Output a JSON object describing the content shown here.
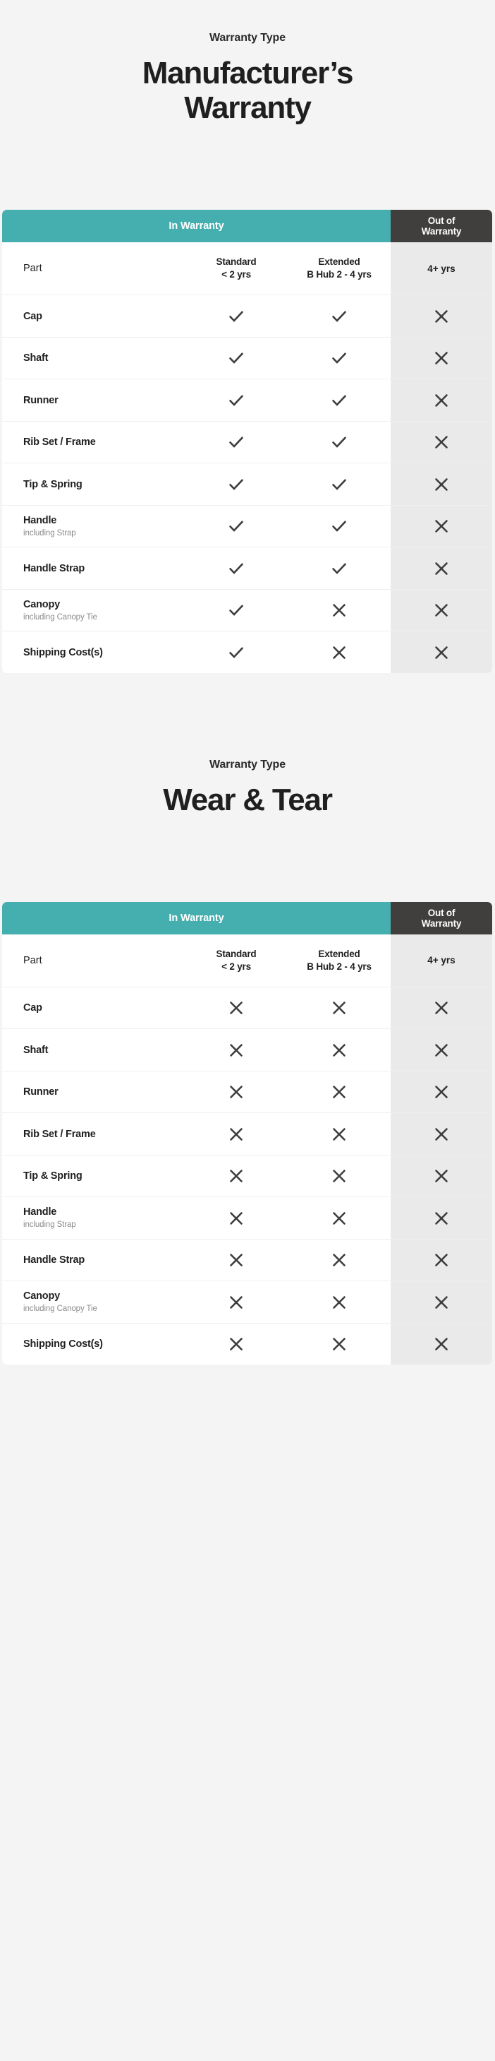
{
  "colors": {
    "teal": "#44AFAE",
    "dark": "#413F3D",
    "page_background": "#F4F4F4",
    "row_background": "#FFFFFF",
    "out_of_warranty_background": "#EAEAEA",
    "muted_text": "#8C8C8C"
  },
  "sections": [
    {
      "eyebrow": "Warranty Type",
      "title_line1": "Manufacturer’s",
      "title_line2": "Warranty",
      "table": {
        "banner": {
          "in_warranty": "In Warranty",
          "out_of_warranty_line1": "Out of",
          "out_of_warranty_line2": "Warranty"
        },
        "columns": {
          "part": "Part",
          "standard_line1": "Standard",
          "standard_line2": "< 2 yrs",
          "extended_line1": "Extended",
          "extended_line2": "B Hub 2 - 4 yrs",
          "out_of_warranty": "4+ yrs"
        },
        "rows": [
          {
            "part": "Cap",
            "sub": "",
            "standard": "check",
            "extended": "check",
            "out": "cross"
          },
          {
            "part": "Shaft",
            "sub": "",
            "standard": "check",
            "extended": "check",
            "out": "cross"
          },
          {
            "part": "Runner",
            "sub": "",
            "standard": "check",
            "extended": "check",
            "out": "cross"
          },
          {
            "part": "Rib Set / Frame",
            "sub": "",
            "standard": "check",
            "extended": "check",
            "out": "cross"
          },
          {
            "part": "Tip & Spring",
            "sub": "",
            "standard": "check",
            "extended": "check",
            "out": "cross"
          },
          {
            "part": "Handle",
            "sub": "including Strap",
            "standard": "check",
            "extended": "check",
            "out": "cross"
          },
          {
            "part": "Handle Strap",
            "sub": "",
            "standard": "check",
            "extended": "check",
            "out": "cross"
          },
          {
            "part": "Canopy",
            "sub": "including Canopy Tie",
            "standard": "check",
            "extended": "cross",
            "out": "cross"
          },
          {
            "part": "Shipping Cost(s)",
            "sub": "",
            "standard": "check",
            "extended": "cross",
            "out": "cross"
          }
        ]
      }
    },
    {
      "eyebrow": "Warranty Type",
      "title_line1": "Wear & Tear",
      "title_line2": "",
      "table": {
        "banner": {
          "in_warranty": "In Warranty",
          "out_of_warranty_line1": "Out of",
          "out_of_warranty_line2": "Warranty"
        },
        "columns": {
          "part": "Part",
          "standard_line1": "Standard",
          "standard_line2": "< 2 yrs",
          "extended_line1": "Extended",
          "extended_line2": "B Hub 2 - 4 yrs",
          "out_of_warranty": "4+ yrs"
        },
        "rows": [
          {
            "part": "Cap",
            "sub": "",
            "standard": "cross",
            "extended": "cross",
            "out": "cross"
          },
          {
            "part": "Shaft",
            "sub": "",
            "standard": "cross",
            "extended": "cross",
            "out": "cross"
          },
          {
            "part": "Runner",
            "sub": "",
            "standard": "cross",
            "extended": "cross",
            "out": "cross"
          },
          {
            "part": "Rib Set / Frame",
            "sub": "",
            "standard": "cross",
            "extended": "cross",
            "out": "cross"
          },
          {
            "part": "Tip & Spring",
            "sub": "",
            "standard": "cross",
            "extended": "cross",
            "out": "cross"
          },
          {
            "part": "Handle",
            "sub": "including Strap",
            "standard": "cross",
            "extended": "cross",
            "out": "cross"
          },
          {
            "part": "Handle Strap",
            "sub": "",
            "standard": "cross",
            "extended": "cross",
            "out": "cross"
          },
          {
            "part": "Canopy",
            "sub": "including Canopy Tie",
            "standard": "cross",
            "extended": "cross",
            "out": "cross"
          },
          {
            "part": "Shipping Cost(s)",
            "sub": "",
            "standard": "cross",
            "extended": "cross",
            "out": "cross"
          }
        ]
      }
    }
  ]
}
